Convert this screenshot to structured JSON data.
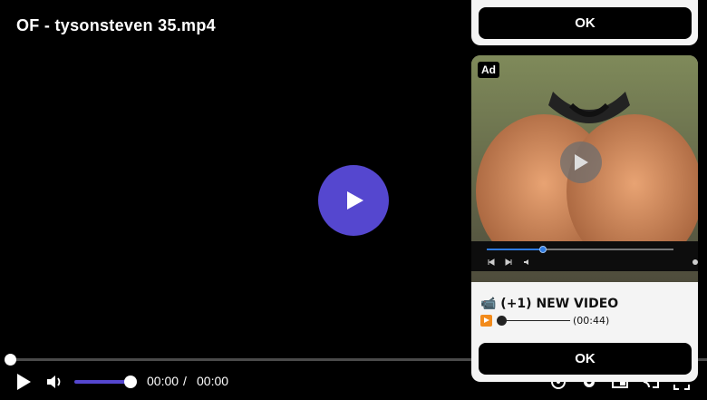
{
  "player": {
    "title": "OF - tysonsteven 35.mp4",
    "time_current": "00:00",
    "time_separator": "/",
    "time_total": "00:00",
    "progress": 0,
    "volume": 1,
    "accent_color": "#5547cf"
  },
  "ad_top": {
    "ok_label": "OK"
  },
  "ad_card": {
    "badge": "Ad",
    "headline": "📹 (+1) NEW VIDEO",
    "duration": "(00:44)",
    "ok_label": "OK"
  }
}
